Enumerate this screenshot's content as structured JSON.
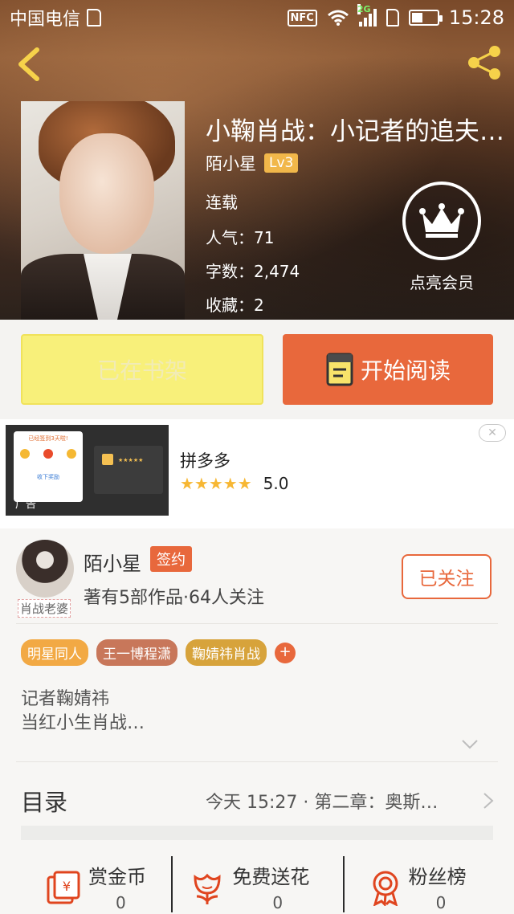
{
  "status_bar": {
    "carrier": "中国电信",
    "nfc": "NFC",
    "network": "2G",
    "time": "15:28",
    "battery_level": 0.45
  },
  "book": {
    "title": "小鞠肖战：小记者的追夫…",
    "author": "陌小星",
    "level": "Lv3",
    "status": "连载",
    "popularity": "人气：71",
    "word_count": "字数：2,474",
    "favorites": "收藏：2"
  },
  "vip": {
    "label": "点亮会员"
  },
  "actions": {
    "shelf_label": "已在书架",
    "read_label": "开始阅读"
  },
  "ad": {
    "app_name": "拼多多",
    "rating": "5.0",
    "star_count": 5,
    "tag": "广告",
    "card_title": "已经签到3天啦!",
    "card_link": "收下奖励"
  },
  "author_info": {
    "name": "陌小星",
    "badge": "签约",
    "avatar_caption": "肖战老婆",
    "stats": "著有5部作品·64人关注",
    "follow_label": "已关注"
  },
  "tags": [
    "明星同人",
    "王一博程潇",
    "鞠婧祎肖战"
  ],
  "tag_add": "+",
  "synopsis": {
    "line1": "记者鞠婧祎",
    "line2": "当红小生肖战…"
  },
  "toc": {
    "title": "目录",
    "latest": "今天 15:27 · 第二章：奥斯…"
  },
  "bottom_bar": [
    {
      "label": "赏金币",
      "count": "0",
      "icon": "red-envelope-icon"
    },
    {
      "label": "免费送花",
      "count": "0",
      "icon": "flower-icon"
    },
    {
      "label": "粉丝榜",
      "count": "0",
      "icon": "medal-icon"
    }
  ],
  "colors": {
    "accent": "#e8683c",
    "shelf_button": "#f8f07a",
    "lv_badge": "#f1b74a"
  }
}
